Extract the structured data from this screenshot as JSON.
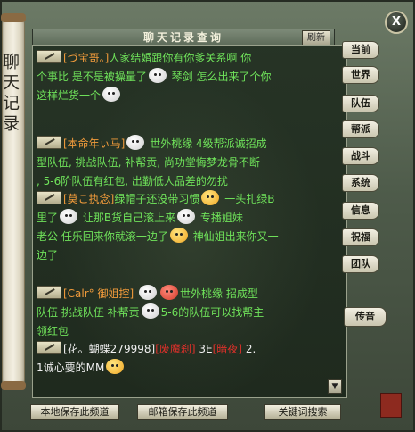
{
  "window": {
    "title": "聊天记录查询",
    "refresh_label": "刷新",
    "close_label": "X",
    "side_banner": "聊天记录"
  },
  "tabs": [
    {
      "label": "当前"
    },
    {
      "label": "世界"
    },
    {
      "label": "队伍"
    },
    {
      "label": "帮派"
    },
    {
      "label": "战斗"
    },
    {
      "label": "系统"
    },
    {
      "label": "信息"
    },
    {
      "label": "祝福"
    },
    {
      "label": "团队"
    },
    {
      "label": "传音"
    }
  ],
  "messages": [
    {
      "sender": "[づ宝哥。]",
      "line1": "人家结婚跟你有你爹关系啊  你",
      "line2a": "个事比 是不是被操量了",
      "line2b": "琴剑 怎么出来了个你",
      "line3": "这样烂货一个"
    },
    {
      "sender": "[本命年ぃ马]",
      "line1": "世外桃缘 4级帮派诚招成",
      "line2": "型队伍, 挑战队伍, 补帮贡, 尚功堂悔梦龙骨不断",
      "line3": ", 5-6阶队伍有红包, 出勤低人品差的勿扰"
    },
    {
      "sender": "[莫こ执念]",
      "line1a": "绿帽子还没带习惯",
      "line1b": "一头扎绿B",
      "line2a": "里了",
      "line2b": "让那B货自己滚上来",
      "line2c": "专播姐妹",
      "line3a": "老公 任乐回来你就滚一边了",
      "line3b": "神仙姐出来你又一",
      "line4": "边了"
    },
    {
      "sender": "[Calr° 御姐控]",
      "line1": "世外桃缘 招成型",
      "line2a": "队伍 挑战队伍 补帮贡",
      "line2b": "5-6的队伍可以找帮主",
      "line3": "领红包"
    },
    {
      "sender": "[花。蝴蝶279998]",
      "tag1": "[废魔刹]",
      "mid": "3E",
      "tag2": "[暗夜]",
      "tail": "2.",
      "line2": "1诚心要的MM"
    }
  ],
  "bottom_buttons": {
    "save_local": "本地保存此频道",
    "save_mail": "邮箱保存此频道",
    "keyword_search": "关键词搜索"
  }
}
